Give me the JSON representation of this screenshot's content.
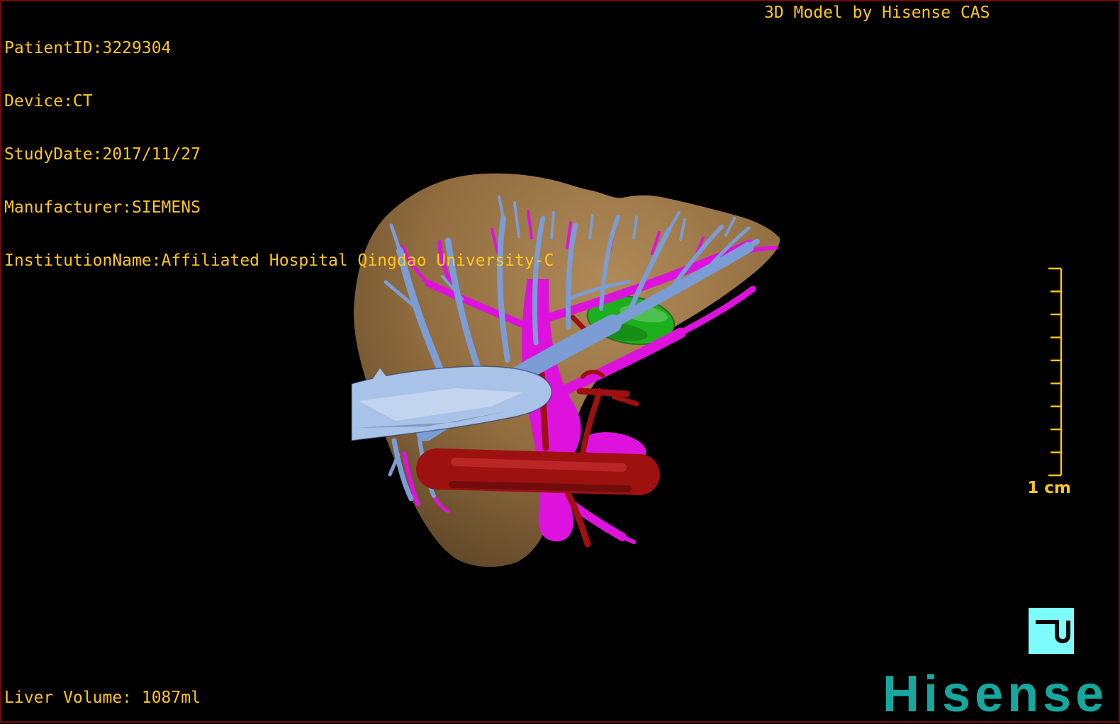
{
  "header": {
    "patient_lines": [
      "PatientID:3229304",
      "Device:CT",
      "StudyDate:2017/11/27",
      "Manufacturer:SIEMENS",
      "InstitutionName:Affiliated Hospital Qingdao University-C"
    ],
    "watermark": "3D Model by Hisense CAS"
  },
  "footer": {
    "liver_volume": "Liver Volume: 1087ml"
  },
  "scale_bar": {
    "label": "1 cm",
    "tick_count": 10
  },
  "branding": {
    "logo": "Hisense"
  },
  "model": {
    "structures": [
      {
        "id": "liver",
        "color": "#8f6b3e"
      },
      {
        "id": "portal-vein-tree",
        "color": "#7b9cd4"
      },
      {
        "id": "ivc-trunk",
        "color": "#a9c2e8"
      },
      {
        "id": "hepatic-vein-tree",
        "color": "#dd13dd"
      },
      {
        "id": "artery-aorta",
        "color": "#9d1111"
      },
      {
        "id": "gallbladder",
        "color": "#1daf1d"
      }
    ]
  },
  "colors": {
    "text_yellow": "#ffc61c",
    "border_maroon": "#700d0d",
    "logo_teal": "#16a89e",
    "icon_cyan": "#7efcfc",
    "liver_light": "#b08a58",
    "liver_tan": "#8f6b3e",
    "liver_dark": "#5a4325",
    "portal_blue": "#7b9cd4",
    "ivc_blue": "#a9c2e8",
    "vein_magenta": "#dd13dd",
    "artery_red": "#9d1111",
    "gb_green": "#1daf1d"
  }
}
